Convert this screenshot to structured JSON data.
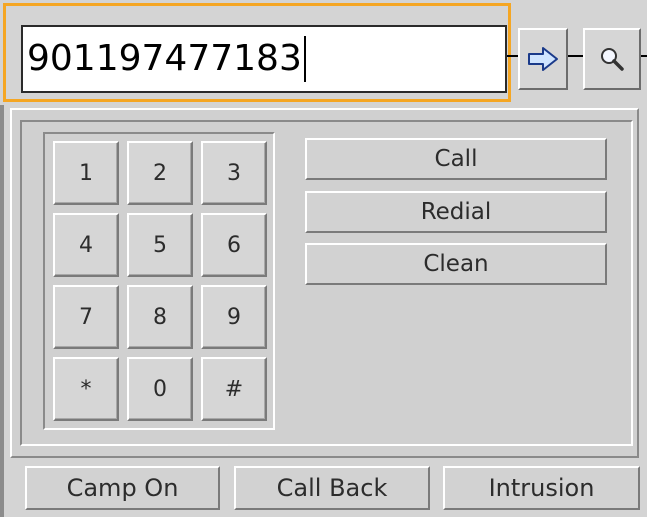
{
  "dialer": {
    "number": "901197477183"
  },
  "toolbar": {
    "go_icon": "arrow-right-icon",
    "search_icon": "magnifier-icon"
  },
  "keypad": {
    "keys": [
      "1",
      "2",
      "3",
      "4",
      "5",
      "6",
      "7",
      "8",
      "9",
      "*",
      "0",
      "#"
    ]
  },
  "actions": {
    "call": "Call",
    "redial": "Redial",
    "clean": "Clean"
  },
  "bottom": {
    "camp_on": "Camp On",
    "call_back": "Call Back",
    "intrusion": "Intrusion"
  },
  "colors": {
    "highlight": "#f5a623",
    "face": "#d4d4d4",
    "arrow_fill": "#cfe4ff"
  }
}
